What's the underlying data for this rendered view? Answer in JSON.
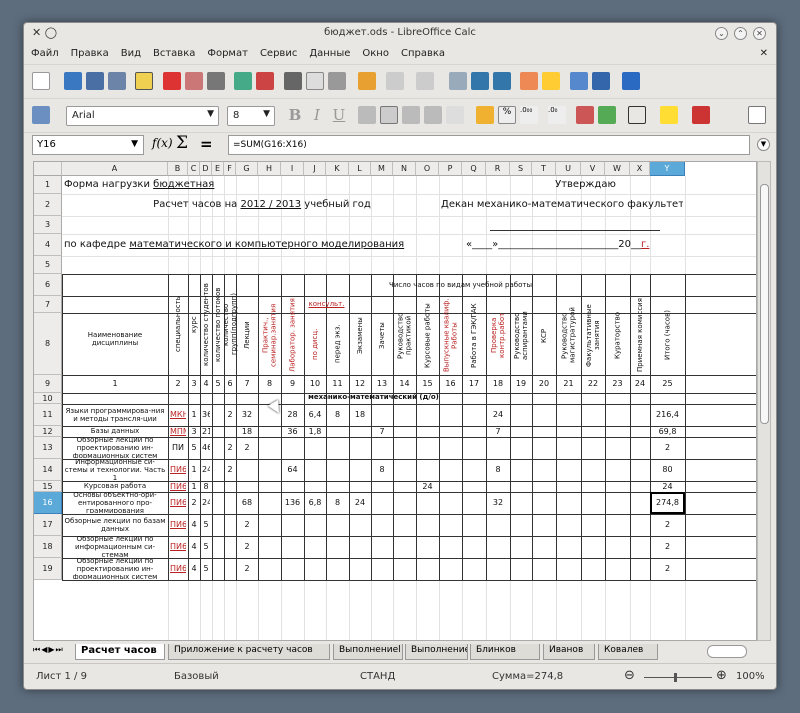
{
  "window": {
    "title": "бюджет.ods - LibreOffice Calc"
  },
  "menu": [
    "Файл",
    "Правка",
    "Вид",
    "Вставка",
    "Формат",
    "Сервис",
    "Данные",
    "Окно",
    "Справка"
  ],
  "toolbar": {
    "font_name": "Arial",
    "font_size": "8"
  },
  "formula_bar": {
    "cell_ref": "Y16",
    "formula": "=SUM(G16:X16)"
  },
  "columns": [
    "A",
    "B",
    "C",
    "D",
    "E",
    "F",
    "G",
    "H",
    "I",
    "J",
    "K",
    "L",
    "M",
    "N",
    "O",
    "P",
    "Q",
    "R",
    "S",
    "T",
    "U",
    "V",
    "W",
    "X",
    "Y"
  ],
  "rows": [
    "1",
    "2",
    "3",
    "4",
    "5",
    "6",
    "7",
    "8",
    "9",
    "10",
    "11",
    "12",
    "13",
    "14",
    "15",
    "16",
    "17",
    "18",
    "19"
  ],
  "sheet": {
    "r1_left": "Форма нагрузки ",
    "r1_left_u": "бюджетная",
    "r1_right": "Утверждаю",
    "r2_pre": "Расчет часов на ",
    "r2_year": "2012 / 2013",
    "r2_post": " учебный год",
    "r2_right": "Декан механико-математического факультета",
    "r4_pre": "по кафедре ",
    "r4_dept": "математического и компьютерного моделирования",
    "r4_date_a": "«",
    "r4_date_b": "»",
    "r4_date_yr": "20",
    "r4_date_g": "г.",
    "hours_header": "Число часов по видам учебной работы",
    "consult": "консульт.",
    "h_name": "Наименование дисциплины",
    "h_spec": "специальность",
    "h_kurs": "курс",
    "h_stud": "количество студентов",
    "h_potok": "количество потоков",
    "h_grupp": "количество групп(подгрупп)",
    "h_lect": "Лекции",
    "h_pract": "Практич., семинар.занятия",
    "h_lab": "Лаборатор. занятия",
    "h_disc": "по дисц.",
    "h_exam_c": "перед экз.",
    "h_exams": "Экзамены",
    "h_zach": "Зачеты",
    "h_pract_r": "Руководство практикой",
    "h_kurs_r": "Курсовые работы",
    "h_vkr": "Выпускные квалиф. Работы",
    "h_gek": "Работа в ГЭК/ГАК",
    "h_kontr": "Проверка контр.работ",
    "h_asp": "Руководство аспирантами",
    "h_ksr": "КСР",
    "h_mag": "Руководство магистратурой",
    "h_fak": "Факультативные занятия",
    "h_kur": "Кураторство",
    "h_priem": "Приемная комиссия",
    "h_total": "Итого (часов)",
    "nums": [
      "1",
      "2",
      "3",
      "4",
      "5",
      "6",
      "7",
      "8",
      "9",
      "10",
      "11",
      "12",
      "13",
      "14",
      "15",
      "16",
      "17",
      "18",
      "19",
      "20",
      "21",
      "22",
      "23",
      "24",
      "25"
    ],
    "r10": "механико-математический (д/о)",
    "data": [
      {
        "a": "Языки программирова-ния и методы трансля-ции",
        "b": "МКН6",
        "c": "1",
        "d": "36",
        "f": "2",
        "g": "32",
        "i": "28",
        "j": "6,4",
        "k": "8",
        "l": "18",
        "r": "24",
        "y": "216,4"
      },
      {
        "a": "Базы данных",
        "b": "МПМ6",
        "c": "3",
        "d": "21",
        "g": "18",
        "i": "36",
        "j": "1,8",
        "m": "7",
        "r": "7",
        "y": "69,8"
      },
      {
        "a": "Обзорные лекции по проектированию ин-формационных систем",
        "b": "ПИ",
        "c": "5",
        "d": "46",
        "f": "2",
        "g": "2",
        "y": "2"
      },
      {
        "a": "Информационные си-стемы и технологии. Часть 1",
        "b": "ПИ6",
        "c": "1",
        "d": "24",
        "f": "2",
        "i": "64",
        "m": "8",
        "r": "8",
        "y": "80"
      },
      {
        "a": "Курсовая работа",
        "b": "ПИ6",
        "c": "1",
        "d": "8",
        "o": "24",
        "y": "24"
      },
      {
        "a": "Основы объектно-ори-ентированного про-граммирования",
        "b": "ПИ6",
        "c": "2",
        "d": "24",
        "g": "68",
        "i": "136",
        "j": "6,8",
        "k": "8",
        "l": "24",
        "r": "32",
        "y": "274,8"
      },
      {
        "a": "Обзорные лекции по базам данных",
        "b": "ПИ6",
        "c": "4",
        "d": "5",
        "g": "2",
        "y": "2"
      },
      {
        "a": "Обзорные лекции по информационным си-стемам",
        "b": "ПИ6",
        "c": "4",
        "d": "5",
        "g": "2",
        "y": "2"
      },
      {
        "a": "Обзорные лекции по проектированию ин-формационных систем",
        "b": "ПИ6",
        "c": "4",
        "d": "5",
        "g": "2",
        "y": "2"
      }
    ]
  },
  "tabs": [
    "Расчет часов",
    "Приложение к расчету часов",
    "Выполнениеl",
    "Выполнениеll",
    "Блинков",
    "Иванов",
    "Ковалев"
  ],
  "status": {
    "sheet": "Лист 1 / 9",
    "style": "Базовый",
    "mode": "СТАНД",
    "sum": "Сумма=274,8",
    "zoom": "100%"
  }
}
